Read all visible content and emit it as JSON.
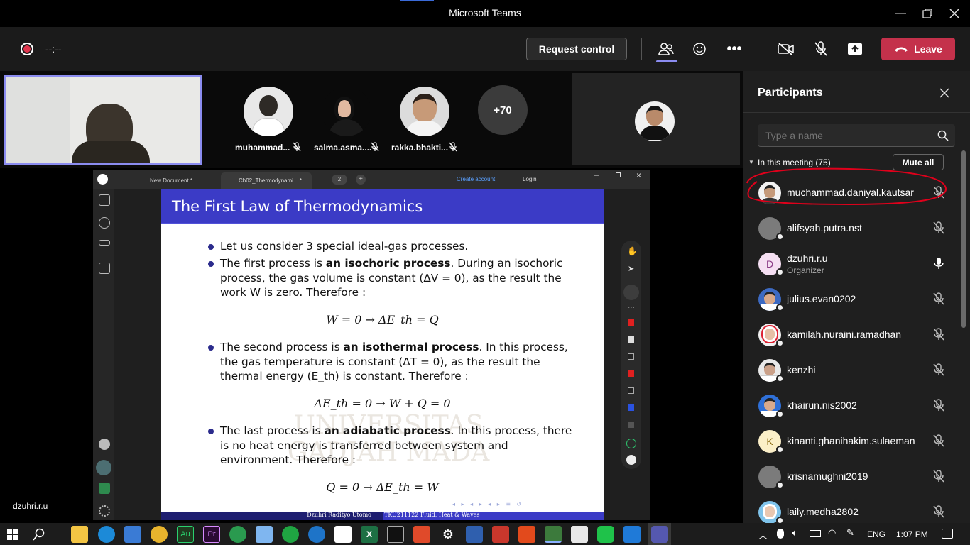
{
  "window": {
    "title": "Microsoft Teams"
  },
  "toolbar": {
    "timer": "--:--",
    "request_control": "Request control",
    "leave": "Leave"
  },
  "gallery": {
    "participants": [
      {
        "name": "muhammad..."
      },
      {
        "name": "salma.asma...."
      },
      {
        "name": "rakka.bhakti..."
      }
    ],
    "more_count": "+70",
    "presenter_label": "dzuhri.r.u"
  },
  "viewer": {
    "tabs": [
      {
        "label": "New Document *"
      },
      {
        "label": "Ch02_Thermodynami... *"
      }
    ],
    "tab_count": "2",
    "create_account": "Create account",
    "login": "Login"
  },
  "slide": {
    "title": "The First Law of Thermodynamics",
    "intro": "Let us consider 3 special ideal-gas processes.",
    "p1_a": "The first process is ",
    "p1_bold": "an isochoric process",
    "p1_b": ". During an isochoric process, the gas volume is constant (ΔV = 0), as the result the work W is zero.  Therefore :",
    "eq1": "W = 0    →    ΔE_th = Q",
    "p2_a": "The second process is ",
    "p2_bold": "an isothermal process",
    "p2_b": ". In this process, the gas temperature is constant (ΔT = 0), as the result the thermal energy (E_th) is constant.  Therefore :",
    "eq2": "ΔE_th = 0    →    W + Q = 0",
    "p3_a": "The last process is ",
    "p3_bold": "an adiabatic process",
    "p3_b": ". In this process, there is no heat energy is transferred between system and environment. Therefore :",
    "eq3": "Q = 0    →    ΔE_th = W",
    "footer_left": "Dzuhri Radityo Utomo",
    "footer_right": "TKU211122  Fluid, Heat & Waves",
    "watermark": "UNIVERSITAS GADJAH MADA"
  },
  "panel": {
    "title": "Participants",
    "search_placeholder": "Type a name",
    "section": "In this meeting (75)",
    "mute_all": "Mute all",
    "people": [
      {
        "name": "muchammad.daniyal.kautsar",
        "role": "",
        "initial": "",
        "mic": "muted"
      },
      {
        "name": "alifsyah.putra.nst",
        "role": "",
        "initial": "",
        "mic": "muted"
      },
      {
        "name": "dzuhri.r.u",
        "role": "Organizer",
        "initial": "D",
        "mic": "on"
      },
      {
        "name": "julius.evan0202",
        "role": "",
        "initial": "",
        "mic": "muted"
      },
      {
        "name": "kamilah.nuraini.ramadhan",
        "role": "",
        "initial": "",
        "mic": "muted"
      },
      {
        "name": "kenzhi",
        "role": "",
        "initial": "",
        "mic": "muted"
      },
      {
        "name": "khairun.nis2002",
        "role": "",
        "initial": "",
        "mic": "muted"
      },
      {
        "name": "kinanti.ghanihakim.sulaeman",
        "role": "",
        "initial": "K",
        "mic": "muted"
      },
      {
        "name": "krisnamughni2019",
        "role": "",
        "initial": "",
        "mic": "muted"
      },
      {
        "name": "laily.medha2802",
        "role": "",
        "initial": "",
        "mic": "muted"
      }
    ]
  },
  "taskbar": {
    "lang": "ENG",
    "time": "1:07 PM"
  },
  "colors": {
    "accent": "#6264a7",
    "leave": "#c4314b",
    "slide_header": "#3b3bc6",
    "annotation": "#e0001b"
  }
}
